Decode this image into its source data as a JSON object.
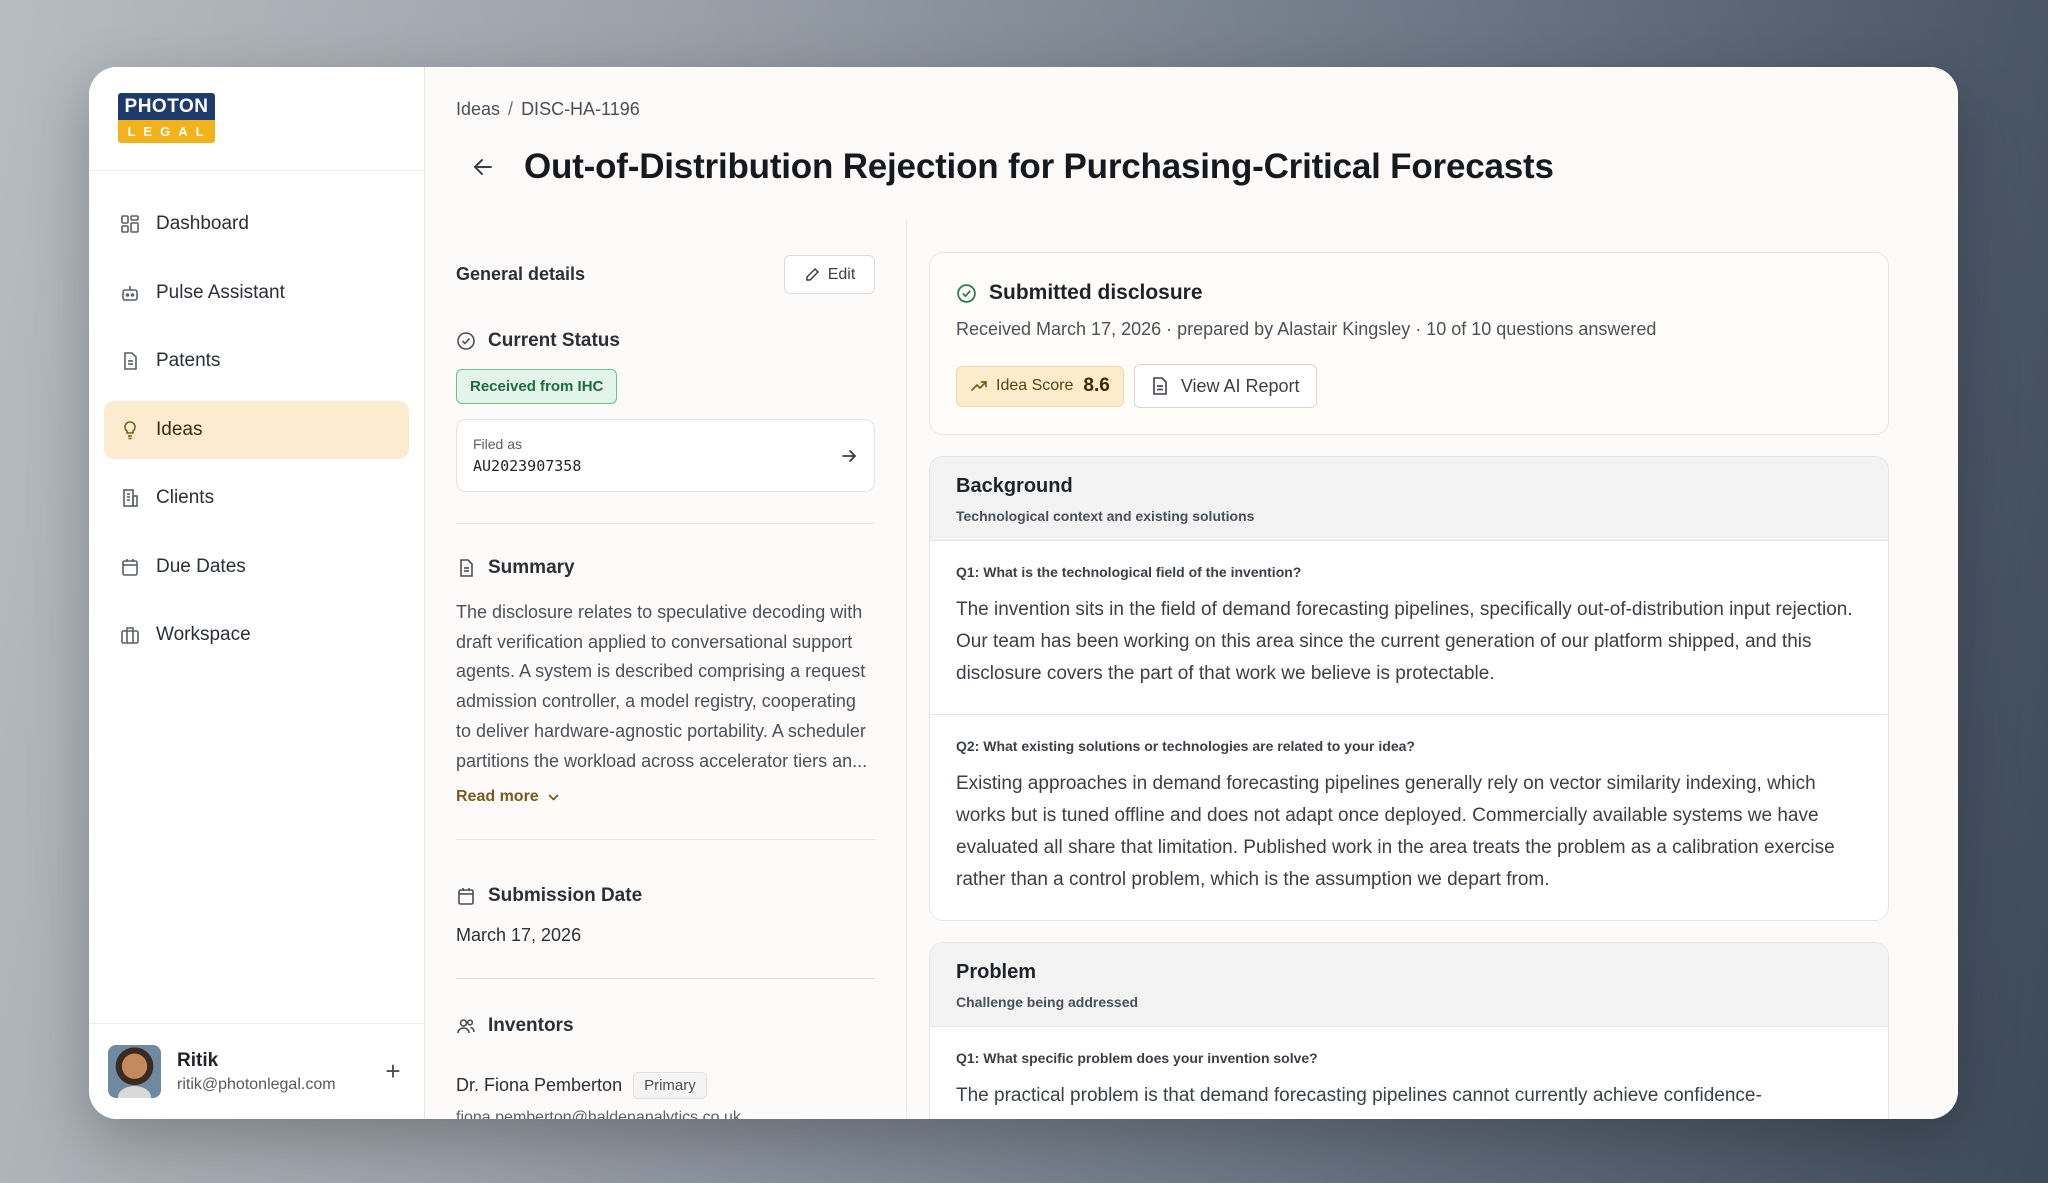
{
  "brand": {
    "top": "PHOTON",
    "bottom": "LEGAL"
  },
  "sidebar": {
    "items": [
      {
        "label": "Dashboard",
        "icon": "grid-icon"
      },
      {
        "label": "Pulse Assistant",
        "icon": "bot-icon"
      },
      {
        "label": "Patents",
        "icon": "document-icon"
      },
      {
        "label": "Ideas",
        "icon": "lightbulb-icon",
        "active": true
      },
      {
        "label": "Clients",
        "icon": "building-icon"
      },
      {
        "label": "Due Dates",
        "icon": "calendar-icon"
      },
      {
        "label": "Workspace",
        "icon": "briefcase-icon"
      }
    ]
  },
  "user": {
    "name": "Ritik",
    "email": "ritik@photonlegal.com",
    "add_label": "+"
  },
  "breadcrumb": {
    "root": "Ideas",
    "separator": "/",
    "current": "DISC-HA-1196"
  },
  "page_title": "Out-of-Distribution Rejection for Purchasing-Critical Forecasts",
  "details": {
    "title": "General details",
    "edit_label": "Edit",
    "status_heading": "Current Status",
    "status_value": "Received from IHC",
    "filed_label": "Filed as",
    "filed_number": "AU2023907358",
    "summary_heading": "Summary",
    "summary_text": "The disclosure relates to speculative decoding with draft verification applied to conversational support agents. A system is described comprising a request admission controller, a model registry, cooperating to deliver hardware-agnostic portability. A scheduler partitions the workload across accelerator tiers an...",
    "read_more": "Read more",
    "submission_heading": "Submission Date",
    "submission_value": "March 17, 2026",
    "inventors_heading": "Inventors",
    "inventor_name": "Dr. Fiona Pemberton",
    "inventor_badge": "Primary",
    "inventor_email": "fiona.pemberton@haldenanalytics.co.uk"
  },
  "disclosure": {
    "title": "Submitted disclosure",
    "meta": "Received March 17, 2026 · prepared by Alastair Kingsley · 10 of 10 questions answered",
    "idea_score_label": "Idea Score",
    "idea_score_value": "8.6",
    "ai_report_label": "View AI Report"
  },
  "sections": [
    {
      "title": "Background",
      "subtitle": "Technological context and existing solutions",
      "items": [
        {
          "q": "Q1: What is the technological field of the invention?",
          "a": "The invention sits in the field of demand forecasting pipelines, specifically out-of-distribution input rejection. Our team has been working on this area since the current generation of our platform shipped, and this disclosure covers the part of that work we believe is protectable."
        },
        {
          "q": "Q2: What existing solutions or technologies are related to your idea?",
          "a": "Existing approaches in demand forecasting pipelines generally rely on vector similarity indexing, which works but is tuned offline and does not adapt once deployed. Commercially available systems we have evaluated all share that limitation. Published work in the area treats the problem as a calibration exercise rather than a control problem, which is the assumption we depart from."
        }
      ]
    },
    {
      "title": "Problem",
      "subtitle": "Challenge being addressed",
      "items": [
        {
          "q": "Q1: What specific problem does your invention solve?",
          "a": "The practical problem is that demand forecasting pipelines cannot currently achieve confidence-"
        }
      ]
    }
  ]
}
